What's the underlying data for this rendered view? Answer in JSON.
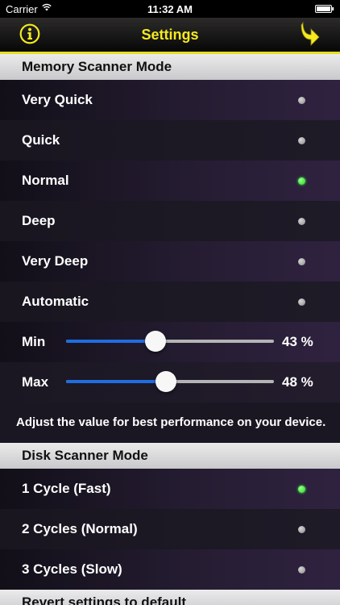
{
  "status_bar": {
    "carrier": "Carrier",
    "time": "11:32 AM"
  },
  "nav": {
    "title": "Settings"
  },
  "memory_section": {
    "header": "Memory Scanner Mode",
    "options": [
      {
        "label": "Very Quick",
        "selected": false
      },
      {
        "label": "Quick",
        "selected": false
      },
      {
        "label": "Normal",
        "selected": true
      },
      {
        "label": "Deep",
        "selected": false
      },
      {
        "label": "Very Deep",
        "selected": false
      },
      {
        "label": "Automatic",
        "selected": false
      }
    ],
    "min_slider": {
      "label": "Min",
      "value": 43,
      "display": "43 %"
    },
    "max_slider": {
      "label": "Max",
      "value": 48,
      "display": "48 %"
    },
    "note": "Adjust the value for best performance on your device."
  },
  "disk_section": {
    "header": "Disk Scanner Mode",
    "options": [
      {
        "label": "1 Cycle (Fast)",
        "selected": true
      },
      {
        "label": "2 Cycles (Normal)",
        "selected": false
      },
      {
        "label": "3 Cycles (Slow)",
        "selected": false
      }
    ]
  },
  "revert": {
    "label": "Revert settings to default"
  },
  "colors": {
    "accent": "#f4ea1f",
    "selected_dot": "#1ed81e",
    "unselected_dot": "#a8a8a8",
    "slider_fill": "#1f6de0"
  }
}
